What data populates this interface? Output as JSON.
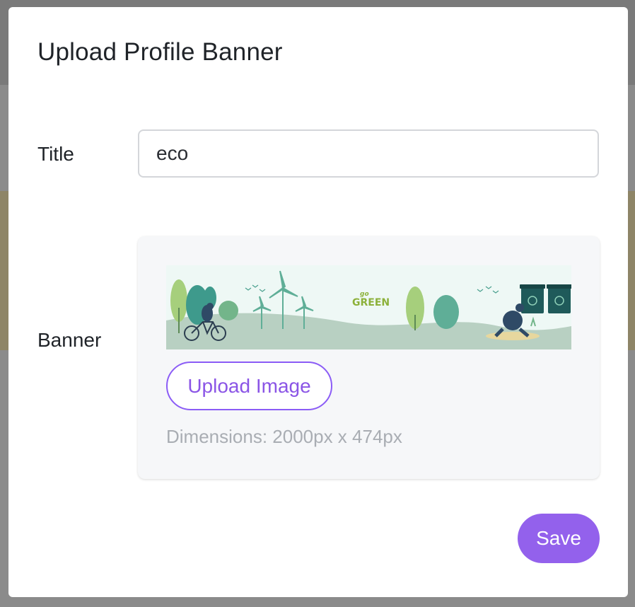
{
  "modal": {
    "title": "Upload Profile Banner",
    "title_label": "Title",
    "title_value": "eco",
    "banner_label": "Banner",
    "banner_image_text": "go GREEN",
    "upload_button": "Upload Image",
    "dimensions_text": "Dimensions: 2000px x 474px",
    "save_button": "Save"
  },
  "colors": {
    "accent": "#8b5cf6",
    "save_background": "#9361ec",
    "banner_green_text": "#8cb13a"
  }
}
